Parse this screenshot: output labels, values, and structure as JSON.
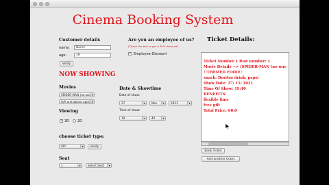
{
  "app": {
    "title": "Cinema Booking System"
  },
  "customer": {
    "heading": "Customer details",
    "name_label": "name:",
    "name_value": "Naren",
    "age_label": "age:",
    "age_value": "18",
    "verify_label": "Verify"
  },
  "employee": {
    "question": "Are you an employee of us?",
    "note": "(Check the box to get a 30% discount)",
    "discount_label": "Employee Discount",
    "discount_checked": "✓"
  },
  "now_showing": {
    "heading": "NOW SHOWING",
    "movies_label": "Movies",
    "movie_select": "SPIDER-MAN (no wa…",
    "age_select": "U/A and above options",
    "viewing_label": "Viewing",
    "view_3d": "3D",
    "view_2d": "2D",
    "view_3d_checked": "✓"
  },
  "datetime": {
    "heading": "Date & Showtime",
    "date_label": "Date of show:",
    "day": "27",
    "month": "Nov",
    "year": "2021",
    "time_label": "Time of show:",
    "hour": "19",
    "minute": "40"
  },
  "ticket_type": {
    "label": "choose ticket type:",
    "value": "VIP",
    "verify_label": "Verify"
  },
  "seat": {
    "label": "Seat",
    "row": "1",
    "seat_select": "Select Seat"
  },
  "ticket_details": {
    "heading": "Ticket Details:",
    "lines": [
      "Ticket Number 1 Row number: 1",
      "Movie Details --> (SPIDER-MAN (no way",
      "!!THEMED FOOD!!",
      "snack: Doritos drink: pepsi",
      "Show Date: 27/ 11/ 2021",
      "Time Of Show: 19:40",
      "BENEFITS:",
      "flexible time",
      "free gift",
      "Total Price: 60.0"
    ],
    "book_label": "Book Ticket",
    "add_label": "Add another ticket"
  }
}
